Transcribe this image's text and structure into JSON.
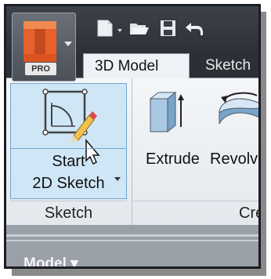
{
  "app": {
    "edition_badge": "PRO",
    "logo_icon": "inventor-logo-icon",
    "brand_color": "#e8612c"
  },
  "quick_access": {
    "icons": [
      "new-file-icon",
      "open-folder-icon",
      "save-icon",
      "undo-icon"
    ]
  },
  "tabs": [
    {
      "label": "3D Model",
      "active": true
    },
    {
      "label": "Sketch",
      "active": false
    }
  ],
  "ribbon": {
    "sketch_panel": {
      "title": "Sketch",
      "start_sketch": {
        "line1": "Start",
        "line2": "2D Sketch",
        "icon": "start-2d-sketch-icon"
      }
    },
    "create_panel": {
      "title": "Creat",
      "tools": [
        {
          "label": "Extrude",
          "icon": "extrude-icon"
        },
        {
          "label": "Revolv",
          "icon": "revolve-icon"
        }
      ]
    }
  },
  "browser": {
    "header": "Model ▾"
  }
}
